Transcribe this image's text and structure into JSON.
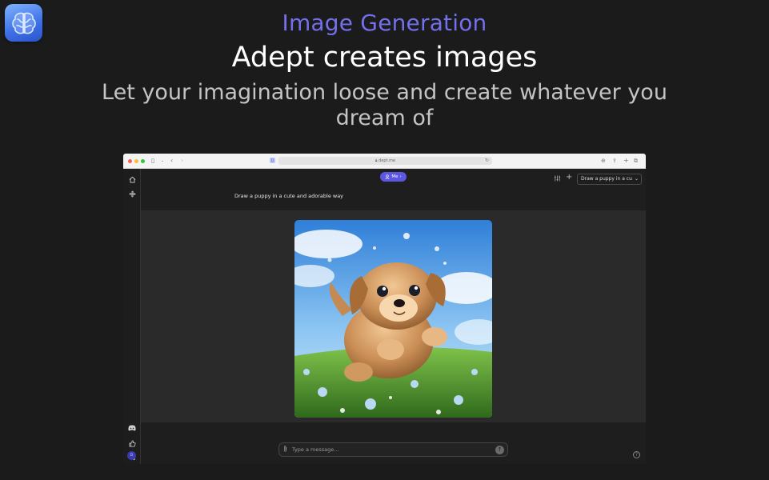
{
  "hero": {
    "eyebrow": "Image Generation",
    "title": "Adept creates images",
    "subtitle": "Let your imagination loose and create whatever you dream of"
  },
  "browser": {
    "url": "dept.me",
    "favicon_letter": "D"
  },
  "sidebar": {
    "avatar_initials": "D",
    "top_icons": [
      "home-icon",
      "fan-icon"
    ],
    "bottom_icons": [
      "discord-icon",
      "thumbs-up-icon",
      "sliders-icon"
    ]
  },
  "topbar": {
    "me_label": "Me",
    "prompt_select_value": "Draw a puppy in a cu"
  },
  "chat": {
    "user_message": "Draw a puppy in a cute and adorable way"
  },
  "composer": {
    "placeholder": "Type a message..."
  },
  "colors": {
    "accent": "#5b57e0",
    "eyebrow": "#7270ec",
    "background": "#1b1b1c"
  }
}
